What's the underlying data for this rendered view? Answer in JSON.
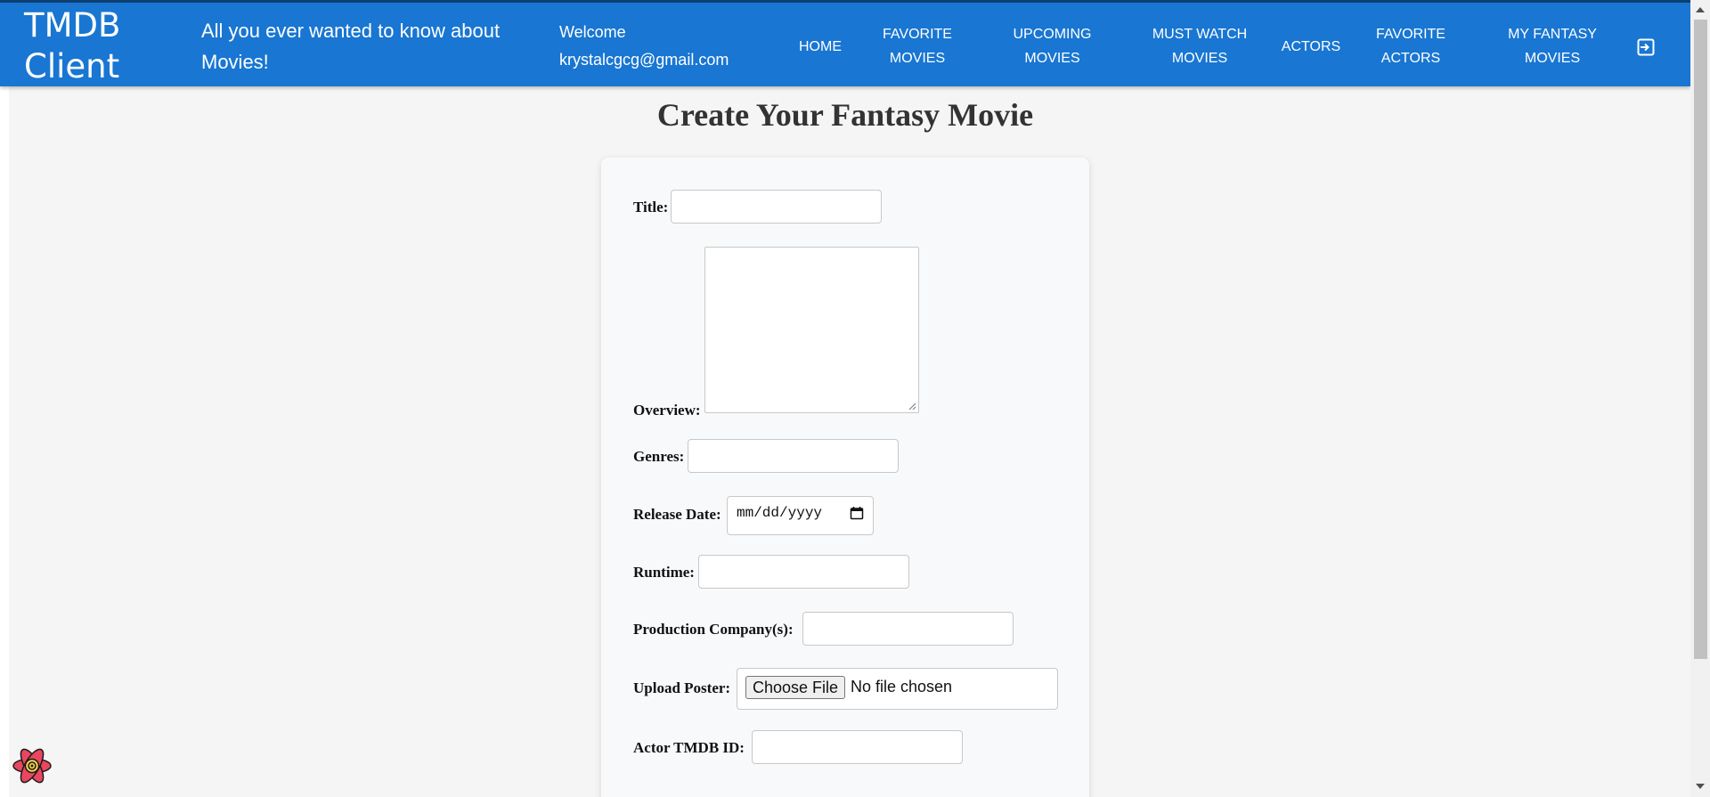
{
  "header": {
    "brand": "TMDB Client",
    "tagline": "All you ever wanted to know about Movies!",
    "welcome": "Welcome krystalcgcg@gmail.com",
    "nav": [
      {
        "label": "Home"
      },
      {
        "label": "Favorite Movies"
      },
      {
        "label": "Upcoming Movies"
      },
      {
        "label": "Must Watch Movies"
      },
      {
        "label": "Actors"
      },
      {
        "label": "Favorite Actors"
      },
      {
        "label": "My Fantasy Movies"
      }
    ],
    "logout_icon": "logout-icon"
  },
  "page": {
    "title": "Create Your Fantasy Movie"
  },
  "form": {
    "title_label": "Title:",
    "title_value": "",
    "overview_label": "Overview:",
    "overview_value": "",
    "genres_label": "Genres:",
    "genres_value": "",
    "release_date_label": "Release Date:",
    "release_date_placeholder": "mm/dd/yyyy",
    "runtime_label": "Runtime:",
    "runtime_value": "",
    "production_label": "Production Company(s):",
    "production_value": "",
    "poster_label": "Upload Poster:",
    "poster_button": "Choose File",
    "poster_status": "No file chosen",
    "actor_label": "Actor TMDB ID:",
    "actor_value": ""
  },
  "colors": {
    "appbar": "#1976d2",
    "page_bg": "#f5f5f5",
    "card_bg": "#f8f9fa"
  }
}
